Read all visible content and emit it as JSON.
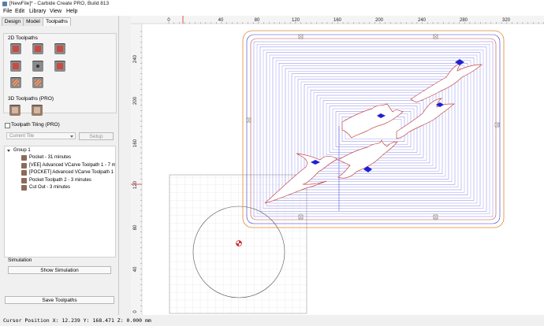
{
  "window": {
    "title": "[NewFile]* - Carbide Create PRO, Build 813"
  },
  "menu": {
    "items": [
      "File",
      "Edit",
      "Library",
      "View",
      "Help"
    ]
  },
  "tabs": [
    "Design",
    "Model",
    "Toolpaths"
  ],
  "active_tab": "Toolpaths",
  "toolpaths_2d": {
    "label": "2D Toolpaths",
    "icons": [
      "contour-toolpath-icon",
      "pocket-toolpath-icon",
      "vcarve-toolpath-icon",
      "chamfer-toolpath-icon",
      "drill-toolpath-icon",
      "advanced-vcarve-icon",
      "texture-toolpath-icon",
      "rest-machining-icon"
    ]
  },
  "toolpaths_3d": {
    "label": "3D Toolpaths (PRO)",
    "icons": [
      "3d-rough-icon",
      "3d-finish-icon"
    ]
  },
  "tiling": {
    "label": "Toolpath Tiling (PRO)",
    "current_tile": "Current Tile",
    "setup": "Setup"
  },
  "tree": {
    "group": "Group 1",
    "items": [
      "Pocket - 31 minutes",
      "[VEE] Advanced VCarve Toolpath 1 - 7 min...",
      "[POCKET] Advanced VCarve Toolpath 1 - E...",
      "Pocket Toolpath 2 - 3 minutes",
      "Cut Out - 3 minutes"
    ]
  },
  "simulation": {
    "label": "Simulation",
    "button": "Show Simulation"
  },
  "save_button": "Save Toolpaths",
  "ruler": {
    "x_ticks": [
      "0",
      "40",
      "80",
      "120",
      "160",
      "200",
      "240",
      "280",
      "320"
    ],
    "y_ticks": [
      "240",
      "200",
      "160",
      "120",
      "80",
      "40",
      "0"
    ]
  },
  "status": {
    "text": "Cursor Position X: 12.239 Y: 168.471 Z: 0.000 mm"
  },
  "colors": {
    "accent": "#3b3bd6",
    "outline": "#c24848",
    "stock": "#e08a2e"
  }
}
